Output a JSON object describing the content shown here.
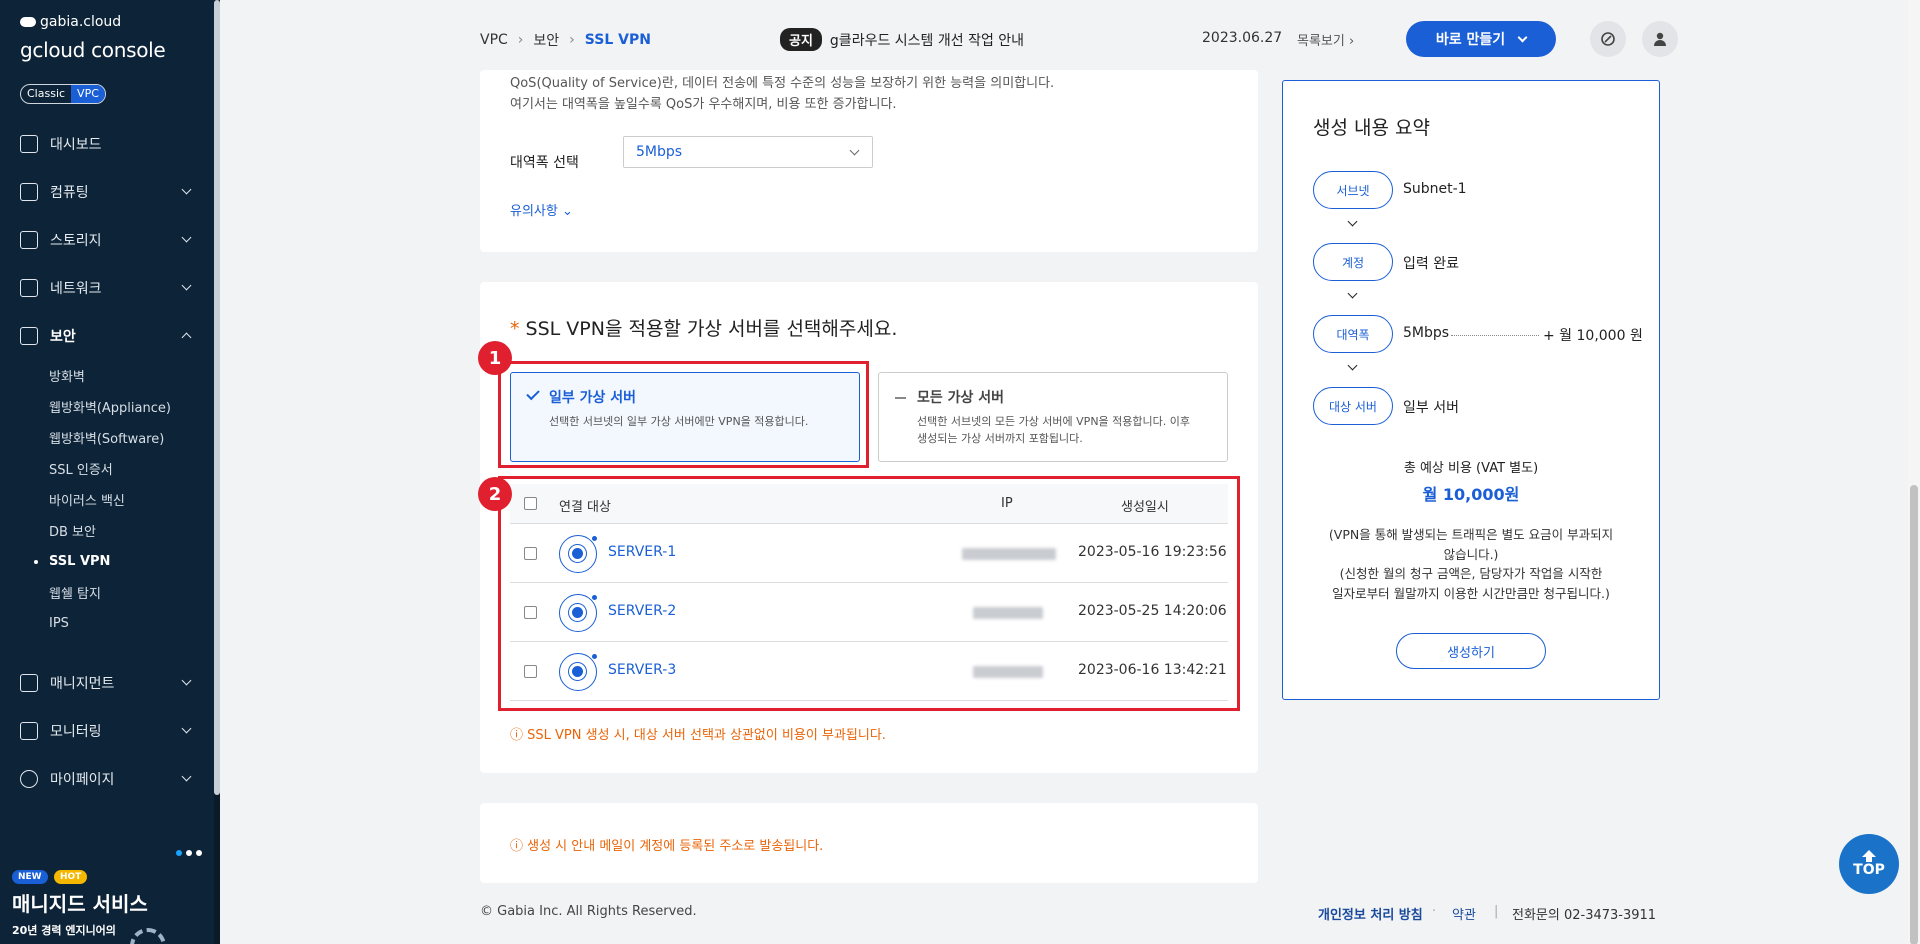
{
  "sidebar": {
    "brand_small": "gabia.cloud",
    "brand_big": "gcloud console",
    "toggle": [
      "Classic",
      "VPC"
    ],
    "nav": [
      {
        "label": "대시보드",
        "icon": "speedometer-icon",
        "chevron": false
      },
      {
        "label": "컴퓨팅",
        "icon": "chip-icon",
        "chevron": true
      },
      {
        "label": "스토리지",
        "icon": "drive-icon",
        "chevron": true
      },
      {
        "label": "네트워크",
        "icon": "network-icon",
        "chevron": true
      },
      {
        "label": "보안",
        "icon": "shield-icon",
        "chevron": true,
        "expanded": true
      }
    ],
    "sub_items": [
      "방화벽",
      "웹방화벽(Appliance)",
      "웹방화벽(Software)",
      "SSL 인증서",
      "바이러스 백신",
      "DB 보안",
      "SSL VPN",
      "웹쉘 탐지",
      "IPS"
    ],
    "current_sub": "SSL VPN",
    "nav_bottom": [
      {
        "label": "매니지먼트",
        "icon": "server-icon"
      },
      {
        "label": "모니터링",
        "icon": "monitor-icon"
      },
      {
        "label": "마이페이지",
        "icon": "user-icon"
      }
    ],
    "promo": {
      "badge_new": "NEW",
      "badge_hot": "HOT",
      "title": "매니지드 서비스",
      "subtitle": "20년 경력 엔지니어의"
    }
  },
  "header": {
    "breadcrumb": [
      "VPC",
      "보안",
      "SSL VPN"
    ],
    "notice_tag": "공지",
    "notice_text": "g클라우드 시스템 개선 작업 안내",
    "notice_date": "2023.06.27",
    "notice_list": "목록보기",
    "create_button": "바로 만들기"
  },
  "bandwidth": {
    "desc1": "QoS(Quality of Service)란, 데이터 전송에 특정 수준의 성능을 보장하기 위한 능력을 의미합니다.",
    "desc2": "여기서는 대역폭을 높일수록 QoS가 우수해지며, 비용 또한 증가합니다.",
    "label": "대역폭 선택",
    "value": "5Mbps",
    "caution": "유의사항"
  },
  "server_select": {
    "required_mark": "*",
    "title": "SSL VPN을 적용할 가상 서버를 선택해주세요.",
    "option_some": {
      "title": "일부 가상 서버",
      "desc": "선택한 서브넷의 일부 가상 서버에만 VPN을 적용합니다."
    },
    "option_all": {
      "title": "모든 가상 서버",
      "desc1": "선택한 서브넷의 모든 가상 서버에 VPN을 적용합니다. 이후",
      "desc2": "생성되는 가상 서버까지 포함됩니다."
    },
    "columns": [
      "연결 대상",
      "IP",
      "생성일시"
    ],
    "rows": [
      {
        "name": "SERVER-1",
        "created": "2023-05-16 19:23:56"
      },
      {
        "name": "SERVER-2",
        "created": "2023-05-25 14:20:06"
      },
      {
        "name": "SERVER-3",
        "created": "2023-06-16 13:42:21"
      }
    ],
    "warning": "ⓘ SSL VPN 생성 시, 대상 서버 선택과 상관없이 비용이 부과됩니다."
  },
  "annotations": [
    "1",
    "2"
  ],
  "mail_notice": "ⓘ 생성 시 안내 메일이 계정에 등록된 주소로 발송됩니다.",
  "summary": {
    "title": "생성 내용 요약",
    "items": [
      {
        "label": "서브넷",
        "value": "Subnet-1"
      },
      {
        "label": "계정",
        "value": "입력 완료"
      },
      {
        "label": "대역폭",
        "value": "5Mbps",
        "price": "+ 월 10,000 원"
      },
      {
        "label": "대상 서버",
        "value": "일부 서버"
      }
    ],
    "cost_label": "총 예상 비용 (VAT 별도)",
    "cost_value": "월 10,000원",
    "note1": "(VPN을 통해 발생되는 트래픽은 별도 요금이 부과되지",
    "note2": "않습니다.)",
    "note3": "(신청한 월의 청구 금액은, 담당자가 작업을 시작한",
    "note4": "일자로부터 월말까지 이용한 시간만큼만 청구됩니다.)",
    "create_button": "생성하기"
  },
  "footer": {
    "copyright": "© Gabia Inc. All Rights Reserved.",
    "privacy": "개인정보 처리 방침",
    "terms": "약관",
    "phone": "전화문의  02-3473-3911",
    "top": "TOP"
  },
  "colors": {
    "accent": "#1a5fd6",
    "annotation": "#e01f2f",
    "sidebar": "#0d2438",
    "warning": "#e8650a"
  }
}
